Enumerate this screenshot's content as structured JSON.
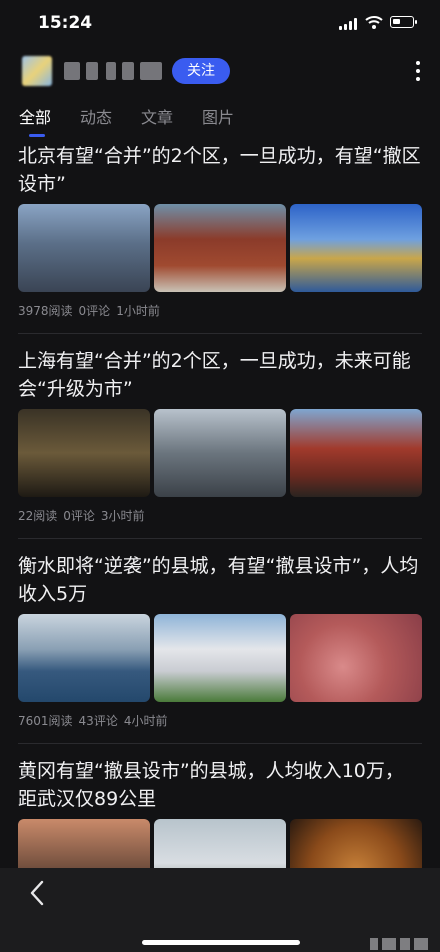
{
  "status": {
    "time": "15:24"
  },
  "header": {
    "follow_label": "关注"
  },
  "tabs": [
    "全部",
    "动态",
    "文章",
    "图片"
  ],
  "articles": [
    {
      "title": "北京有望“合并”的2个区，一旦成功，有望“撤区设市”",
      "reads": "3978阅读",
      "comments": "0评论",
      "time": "1小时前"
    },
    {
      "title": "上海有望“合并”的2个区，一旦成功，未来可能会“升级为市”",
      "reads": "22阅读",
      "comments": "0评论",
      "time": "3小时前"
    },
    {
      "title": "衡水即将“逆袭”的县城，有望“撤县设市”，人均收入5万",
      "reads": "7601阅读",
      "comments": "43评论",
      "time": "4小时前"
    },
    {
      "title": "黄冈有望“撤县设市”的县城，人均收入10万，距武汉仅89公里"
    }
  ],
  "colors": {
    "accent": "#3a5cf0",
    "background": "#121214",
    "meta": "#8a8a90"
  },
  "icons": [
    "signal-icon",
    "wifi-icon",
    "battery-icon",
    "more-icon",
    "back-icon"
  ]
}
